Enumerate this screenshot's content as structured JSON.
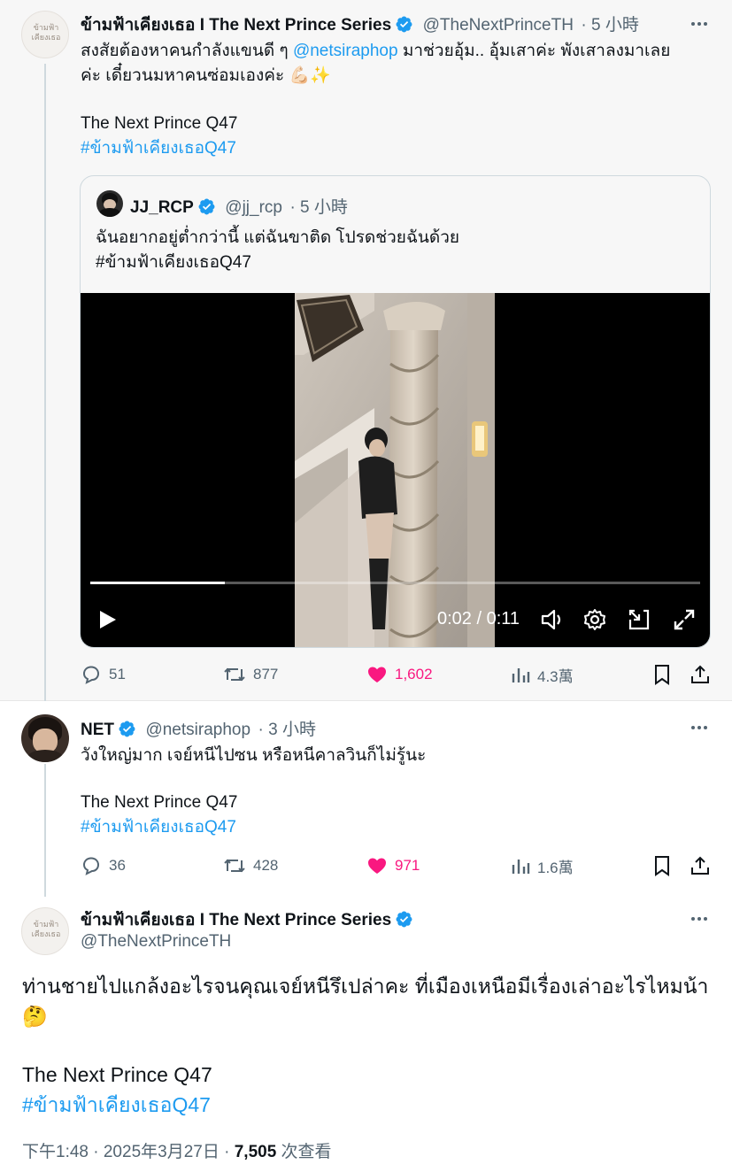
{
  "tweet1": {
    "display_name": "ข้ามฟ้าเคียงเธอ I The Next Prince Series",
    "handle": "@TheNextPrinceTH",
    "time": "· 5 小時",
    "text_line1_pre": "สงสัยต้องหาคนกำลังแขนดี ๆ",
    "text_mention": "@netsiraphop",
    "text_line1_post": "มาช่วยอุ้ม.. อุ้มเสาค่ะ พังเสาลงมาเลย",
    "text_line2": "ค่ะ เดี๋ยวนมหาคนซ่อมเองค่ะ",
    "text_line2_emoji": "💪🏻✨",
    "text_line3": "The Next Prince Q47",
    "hashtag": "#ข้ามฟ้าเคียงเธอQ47",
    "avatar_text": "ข้ามฟ้า\nเคียงเธอ",
    "quote": {
      "display_name": "JJ_RCP",
      "handle": "@jj_rcp",
      "time": "· 5 小時",
      "text_line1": "ฉันอยากอยู่ต่ำกว่านี้ แต่ฉันขาติด โปรดช่วยฉันด้วย",
      "text_line2": "#ข้ามฟ้าเคียงเธอQ47",
      "video": {
        "time_display": "0:02 / 0:11",
        "progress_percent": 22
      }
    },
    "stats": {
      "replies": "51",
      "retweets": "877",
      "likes": "1,602",
      "views": "4.3萬"
    }
  },
  "tweet2": {
    "display_name": "NET",
    "handle": "@netsiraphop",
    "time": "· 3 小時",
    "text_line1": "วังใหญ่มาก เจย์หนีไปซน หรือหนีคาลวินก็ไม่รู้นะ",
    "text_line2": "The Next Prince Q47",
    "hashtag": "#ข้ามฟ้าเคียงเธอQ47",
    "stats": {
      "replies": "36",
      "retweets": "428",
      "likes": "971",
      "views": "1.6萬"
    }
  },
  "tweet3": {
    "display_name": "ข้ามฟ้าเคียงเธอ I The Next Prince Series",
    "handle": "@TheNextPrinceTH",
    "text_line1": "ท่านชายไปแกล้งอะไรจนคุณเจย์หนีรึเปล่าคะ ที่เมืองเหนือมีเรื่องเล่าอะไรไหมน้า",
    "text_emoji": "🤔",
    "text_line2": "The Next Prince Q47",
    "hashtag": "#ข้ามฟ้าเคียงเธอQ47",
    "timestamp": "下午1:48 · 2025年3月27日 · ",
    "views_count": "7,505",
    "views_label": " 次查看"
  },
  "colors": {
    "accent": "#1d9bf0",
    "like_pink": "#f91880",
    "muted": "#536471",
    "verified": "#1d9bf0"
  },
  "icons": [
    "verified-badge-icon",
    "more-options-icon",
    "reply-icon",
    "retweet-icon",
    "like-icon",
    "views-icon",
    "bookmark-icon",
    "share-icon",
    "play-icon",
    "volume-icon",
    "settings-icon",
    "pip-icon",
    "fullscreen-icon"
  ]
}
